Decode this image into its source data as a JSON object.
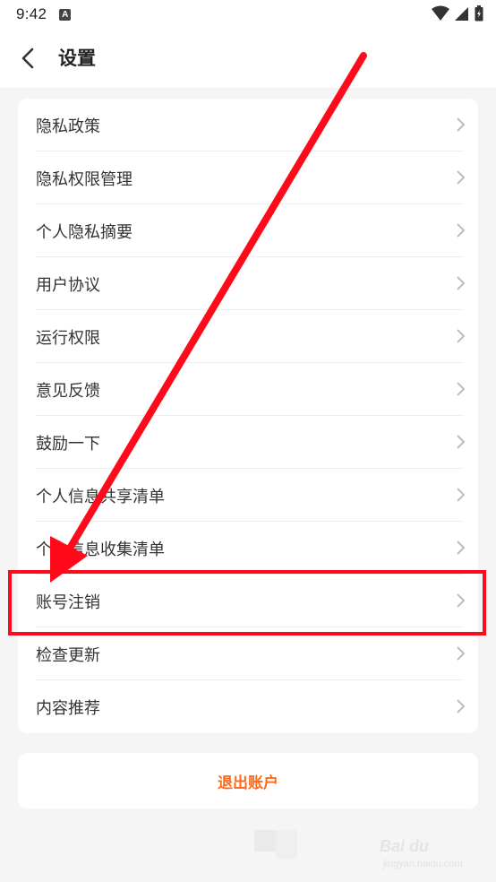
{
  "status_bar": {
    "time": "9:42",
    "notif_letter": "A"
  },
  "header": {
    "title": "设置"
  },
  "settings_items": [
    {
      "label": "隐私政策"
    },
    {
      "label": "隐私权限管理"
    },
    {
      "label": "个人隐私摘要"
    },
    {
      "label": "用户协议"
    },
    {
      "label": "运行权限"
    },
    {
      "label": "意见反馈"
    },
    {
      "label": "鼓励一下"
    },
    {
      "label": "个人信息共享清单"
    },
    {
      "label": "个人信息收集清单"
    },
    {
      "label": "账号注销"
    },
    {
      "label": "检查更新"
    },
    {
      "label": "内容推荐"
    }
  ],
  "logout": {
    "label": "退出账户"
  },
  "annotation": {
    "color": "#ff0a1a"
  },
  "watermark": {
    "main": "Bai du",
    "sub": "jingyan.baidu.com"
  },
  "colors": {
    "accent": "#ff6a1a",
    "background": "#f5f5f5",
    "card": "#ffffff"
  }
}
